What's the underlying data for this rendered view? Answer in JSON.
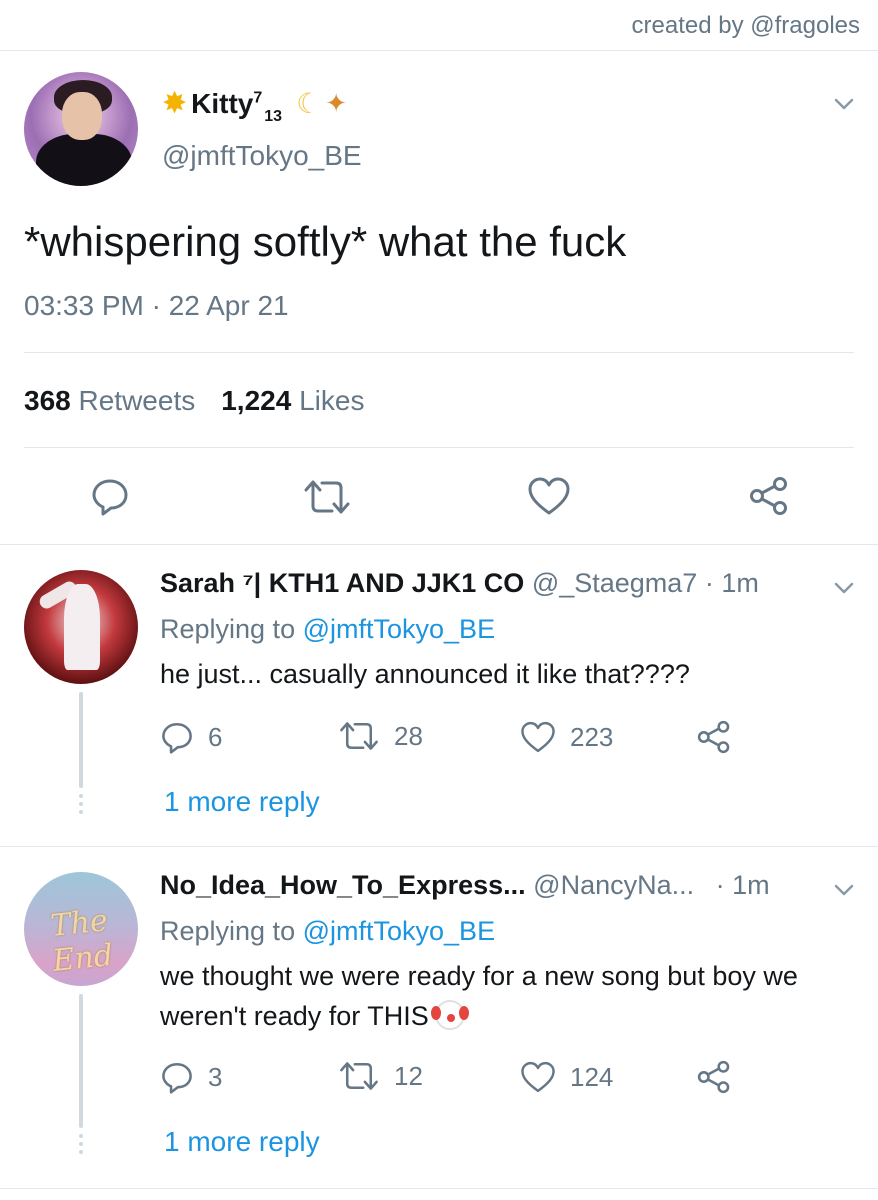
{
  "credit": "created by @fragoles",
  "main_tweet": {
    "display_name": "Kitty",
    "name_sup": "7",
    "name_sub": "13",
    "handle": "@jmftTokyo_BE",
    "text": "*whispering softly* what the fuck",
    "timestamp": "03:33 PM · 22 Apr 21",
    "retweets_count": "368",
    "retweets_label": "Retweets",
    "likes_count": "1,224",
    "likes_label": "Likes",
    "icons": [
      "reply-icon",
      "retweet-icon",
      "like-icon",
      "share-icon"
    ]
  },
  "replies": [
    {
      "name": "Sarah ⁷| KTH1 AND JJK1 CO",
      "handle": "@_Staegma7",
      "time": "· 1m",
      "replying_prefix": "Replying to",
      "replying_to": "@jmftTokyo_BE",
      "text": "he just... casually announced it like that????",
      "reply_count": "6",
      "retweet_count": "28",
      "like_count": "223",
      "more_reply": "1 more reply"
    },
    {
      "name": "No_Idea_How_To_Express...",
      "handle": "@NancyNa...",
      "time": "· 1m",
      "replying_prefix": "Replying to",
      "replying_to": "@jmftTokyo_BE",
      "text": "we thought we were ready for a new song but boy we weren't ready for THIS",
      "avatar_text": "The End",
      "reply_count": "3",
      "retweet_count": "12",
      "like_count": "124",
      "more_reply": "1 more reply"
    }
  ],
  "colors": {
    "text": "#14171a",
    "muted": "#657786",
    "link": "#1b95e0",
    "divider": "#e1e8ed"
  }
}
